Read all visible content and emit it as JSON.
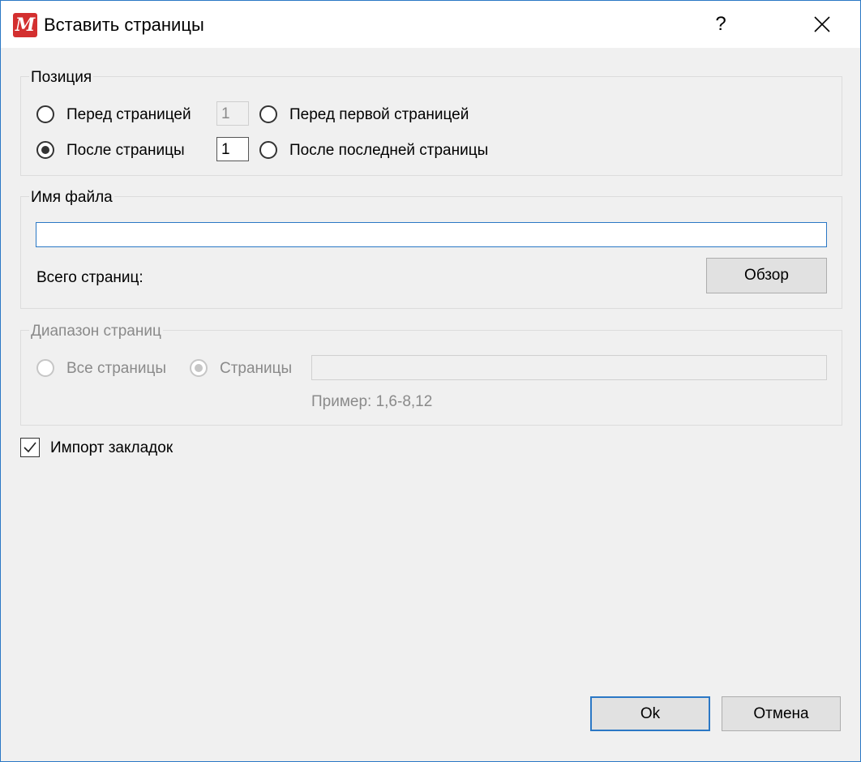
{
  "window": {
    "title": "Вставить страницы",
    "help_label": "?"
  },
  "position_group": {
    "label": "Позиция",
    "before_page_label": "Перед страницей",
    "before_page_value": "1",
    "after_page_label": "После страницы",
    "after_page_value": "1",
    "before_first_label": "Перед первой страницей",
    "after_last_label": "После последней страницы",
    "selected": "after_page"
  },
  "file_group": {
    "label": "Имя файла",
    "filename_value": "",
    "total_pages_label": "Всего страниц:",
    "browse_label": "Обзор"
  },
  "range_group": {
    "label": "Диапазон страниц",
    "all_pages_label": "Все страницы",
    "pages_label": "Страницы",
    "pages_value": "",
    "example_label": "Пример: 1,6-8,12",
    "selected": "pages"
  },
  "import_bookmarks": {
    "label": "Импорт закладок",
    "checked": true
  },
  "buttons": {
    "ok_label": "Ok",
    "cancel_label": "Отмена"
  },
  "colors": {
    "accent": "#2b78c5",
    "app_icon": "#d32f2f"
  }
}
